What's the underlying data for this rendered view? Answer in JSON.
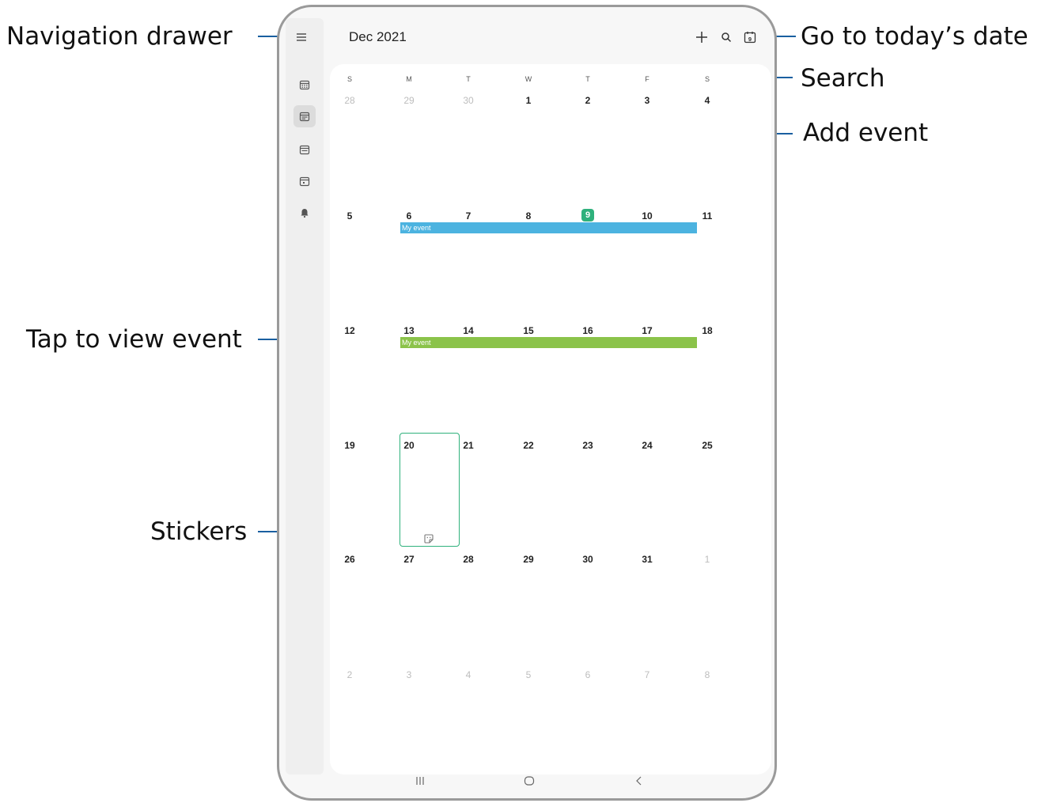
{
  "callouts": {
    "nav_drawer": "Navigation drawer",
    "go_today": "Go to today’s date",
    "search": "Search",
    "add_event": "Add event",
    "tap_event": "Tap to view event",
    "stickers": "Stickers"
  },
  "header": {
    "month_label": "Dec 2021",
    "today_icon_number": "9"
  },
  "rail": {
    "icons": [
      "year-view-icon",
      "month-view-icon",
      "week-view-icon",
      "day-view-icon",
      "reminder-bell-icon"
    ]
  },
  "weekdays": [
    "S",
    "M",
    "T",
    "W",
    "T",
    "F",
    "S"
  ],
  "weeks": [
    [
      "28",
      "29",
      "30",
      "1",
      "2",
      "3",
      "4"
    ],
    [
      "5",
      "6",
      "7",
      "8",
      "9",
      "10",
      "11"
    ],
    [
      "12",
      "13",
      "14",
      "15",
      "16",
      "17",
      "18"
    ],
    [
      "19",
      "20",
      "21",
      "22",
      "23",
      "24",
      "25"
    ],
    [
      "26",
      "27",
      "28",
      "29",
      "30",
      "31",
      "1"
    ],
    [
      "2",
      "3",
      "4",
      "5",
      "6",
      "7",
      "8"
    ]
  ],
  "events": [
    {
      "label": "My event",
      "color": "#4cb3e0"
    },
    {
      "label": "My event",
      "color": "#8bc34a"
    }
  ],
  "colors": {
    "accent": "#2fb17c",
    "leader": "#1a5fa0"
  }
}
